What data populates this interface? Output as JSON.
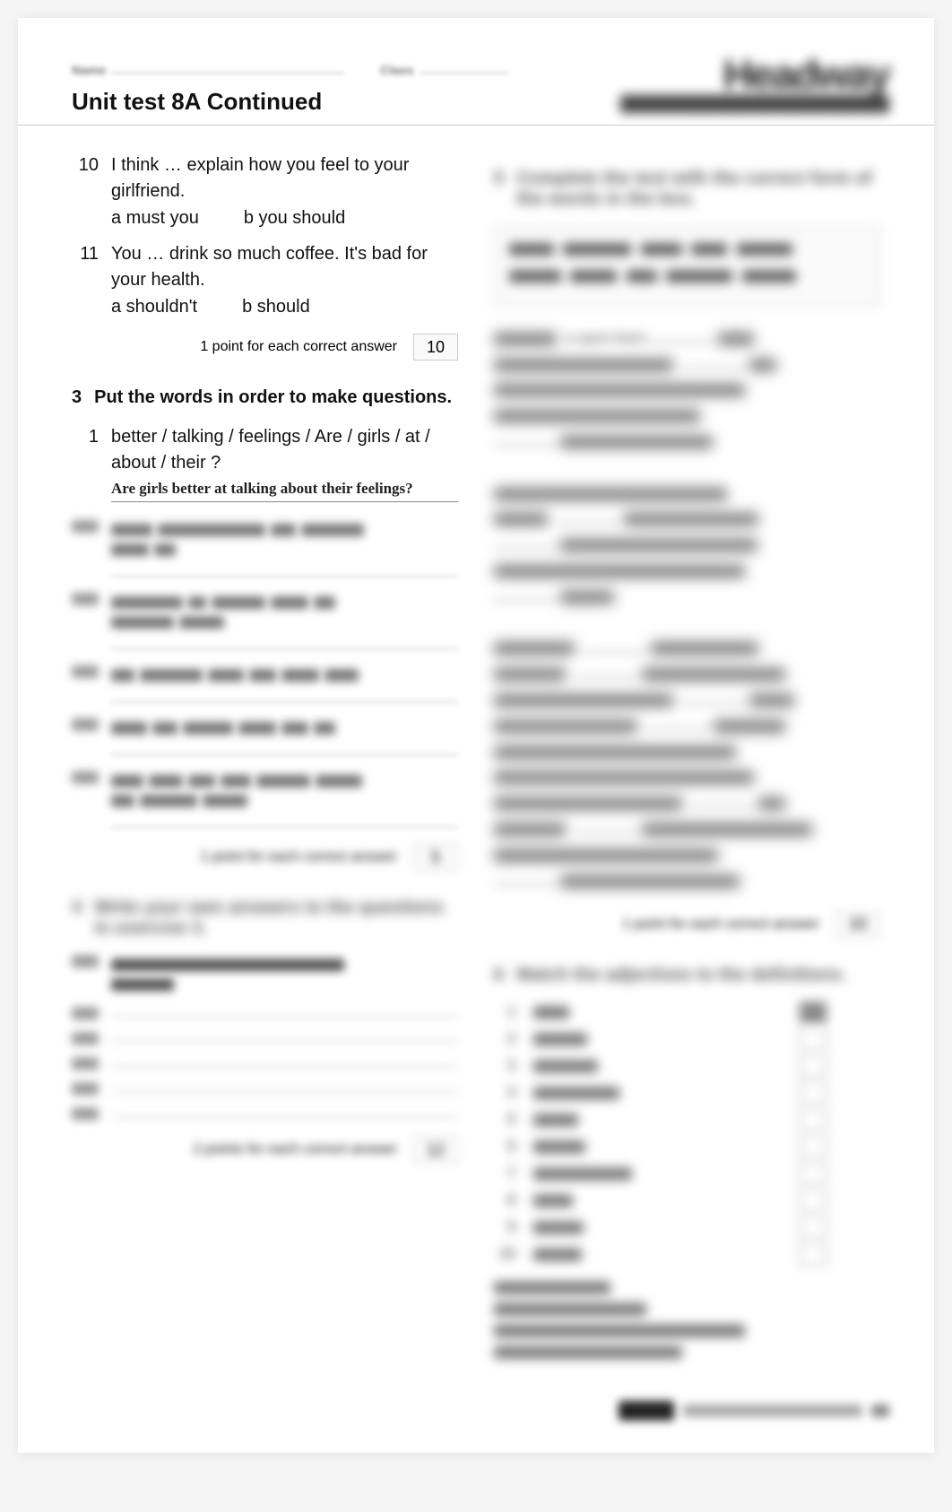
{
  "header": {
    "name_label": "Name",
    "class_label": "Class"
  },
  "brand": {
    "title": "Headway",
    "sub_left": "Pre-Intermediate",
    "sub_right": "FOURTH EDITION"
  },
  "title": "Unit test 8A  Continued",
  "left": {
    "q10": {
      "num": "10",
      "text": "I think … explain how you feel to your girlfriend.",
      "a": "a  must you",
      "b": "b  you should"
    },
    "q11": {
      "num": "11",
      "text": "You … drink so much coffee. It's bad for your health.",
      "a": "a  shouldn't",
      "b": "b  should"
    },
    "score1": {
      "label": "1 point for each correct answer",
      "value": "10"
    },
    "s3": {
      "num": "3",
      "head": "Put the words in order to make questions."
    },
    "s3q1": {
      "num": "1",
      "text": "better / talking / feelings / Are / girls / at / about / their ?"
    },
    "s3example": "Are girls better at talking about their feelings?",
    "score2": {
      "label": "1 point for each correct answer",
      "value": "5"
    },
    "s4": {
      "num": "4",
      "head": "Write your own answers to the questions in exercise 3."
    },
    "s4example": "I think girls are better at talking about their feelings.",
    "score3": {
      "label": "2 points for each correct answer",
      "value": "12"
    }
  },
  "right": {
    "s5": {
      "num": "5",
      "head": "Complete the text with the correct form of the words in the box."
    },
    "score4": {
      "label": "1 point for each correct answer",
      "value": "10"
    },
    "s6": {
      "num": "6",
      "head": "Match the adjectives to the definitions."
    }
  }
}
